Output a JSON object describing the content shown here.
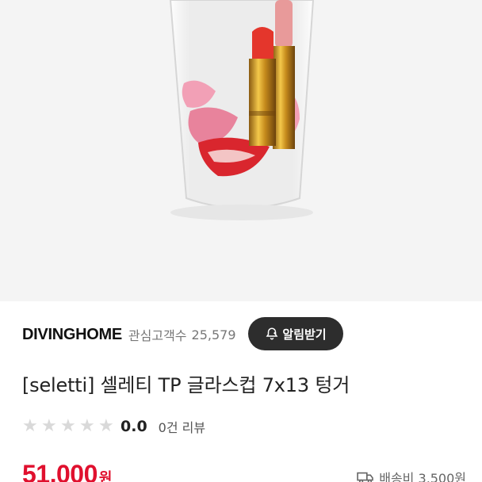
{
  "product": {
    "seller_name": "DIVINGHOME",
    "follower_label": "관심고객수",
    "follower_count": "25,579",
    "notify_label": "알림받기",
    "title": "[seletti] 셀레티 TP 글라스컵 7x13 텅거",
    "rating": "0.0",
    "rating_stars_filled": 0,
    "rating_stars_total": 5,
    "review_count": "0건 리뷰",
    "price": "51,000",
    "price_unit": "원",
    "shipping": "배송비 3,500원"
  },
  "icons": {
    "bell": "bell-icon",
    "star": "star-icon",
    "truck": "truck-icon"
  },
  "colors": {
    "price": "#e0102e",
    "notify_button_bg": "#2d2d2d",
    "star_empty": "#d9d9d9"
  }
}
